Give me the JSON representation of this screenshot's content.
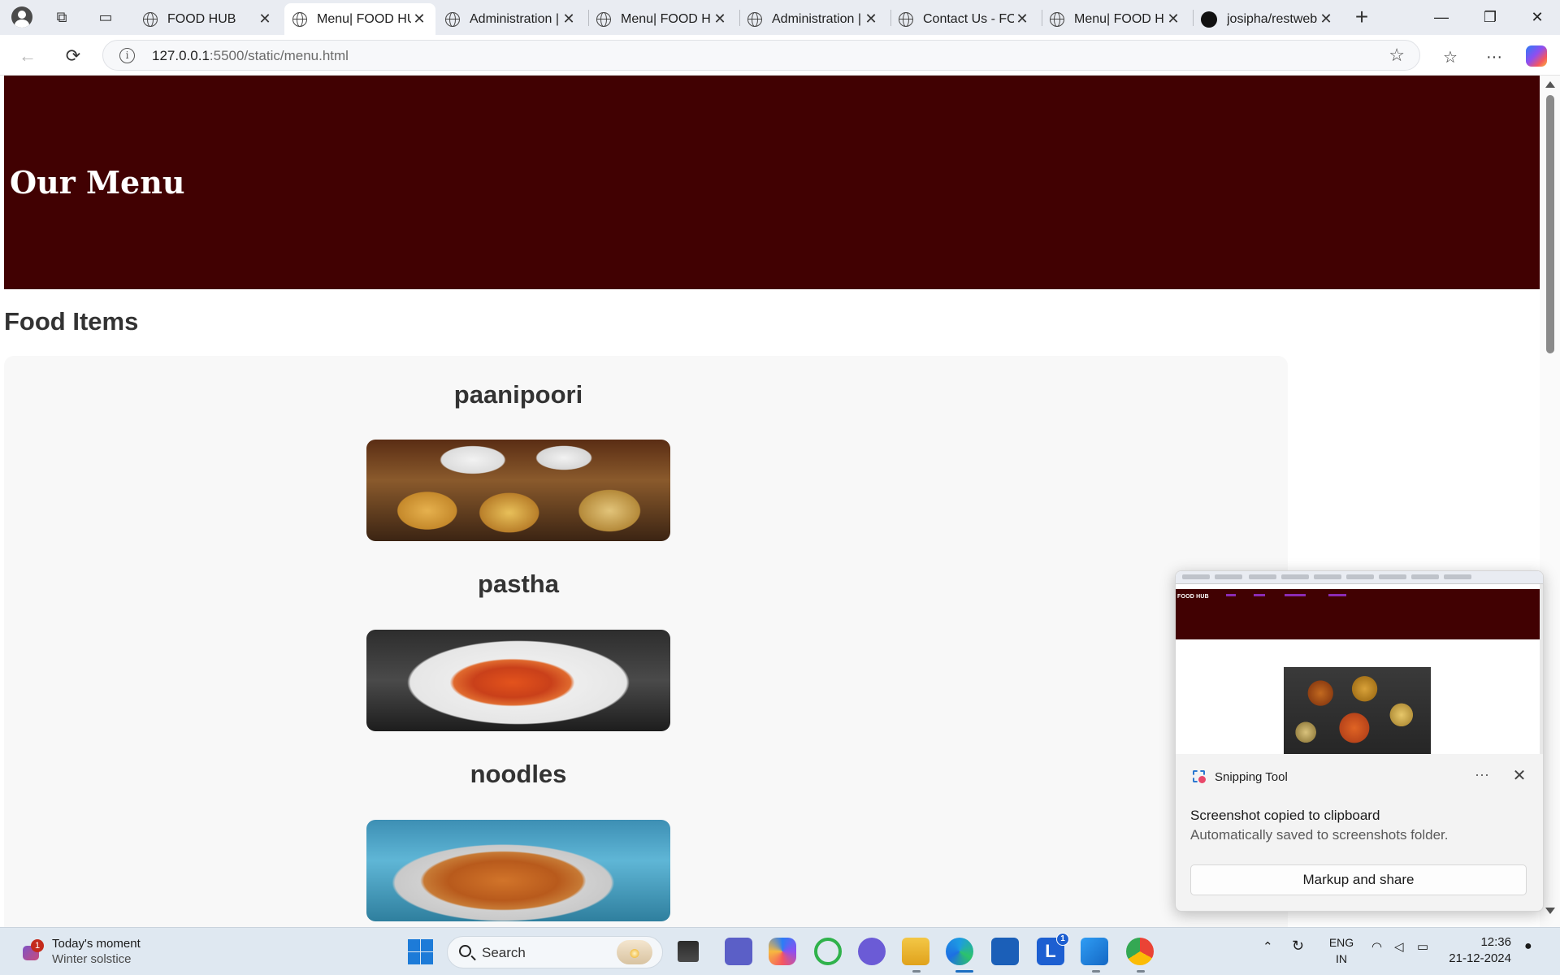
{
  "browser": {
    "tabs": [
      {
        "title": "FOOD HUB",
        "icon": "globe-icon",
        "active": false
      },
      {
        "title": "Menu| FOOD HUB",
        "icon": "globe-icon",
        "active": true
      },
      {
        "title": "Administration |",
        "icon": "globe-icon",
        "active": false
      },
      {
        "title": "Menu| FOOD HUB",
        "icon": "globe-icon",
        "active": false
      },
      {
        "title": "Administration |",
        "icon": "globe-icon",
        "active": false
      },
      {
        "title": "Contact Us - FOOD HUB",
        "icon": "globe-icon",
        "active": false
      },
      {
        "title": "Menu| FOOD HUB",
        "icon": "globe-icon",
        "active": false
      },
      {
        "title": "josipha/restweb",
        "icon": "github-icon",
        "active": false
      }
    ],
    "url_host": "127.0.0.1",
    "url_rest": ":5500/static/menu.html",
    "window_controls": {
      "minimize": "—",
      "restore": "❐",
      "close": "✕"
    }
  },
  "page": {
    "hero_title": "Our Menu",
    "section_title": "Food Items",
    "foods": [
      {
        "name": "paanipoori"
      },
      {
        "name": "pastha"
      },
      {
        "name": "noodles"
      }
    ],
    "colors": {
      "hero_bg": "#410102",
      "card_bg": "#f8f8f8"
    }
  },
  "snipping_toast": {
    "app_name": "Snipping Tool",
    "more": "···",
    "close": "✕",
    "message": "Screenshot copied to clipboard",
    "detail": "Automatically saved to screenshots folder.",
    "button": "Markup and share",
    "thumbnail_brand": "FOOD HUB"
  },
  "taskbar": {
    "weather_title": "Today's moment",
    "weather_subtitle": "Winter solstice",
    "weather_badge": "1",
    "search_label": "Search",
    "lang_top": "ENG",
    "lang_bottom": "IN",
    "time": "12:36",
    "date": "21-12-2024",
    "store_badge": "1"
  }
}
